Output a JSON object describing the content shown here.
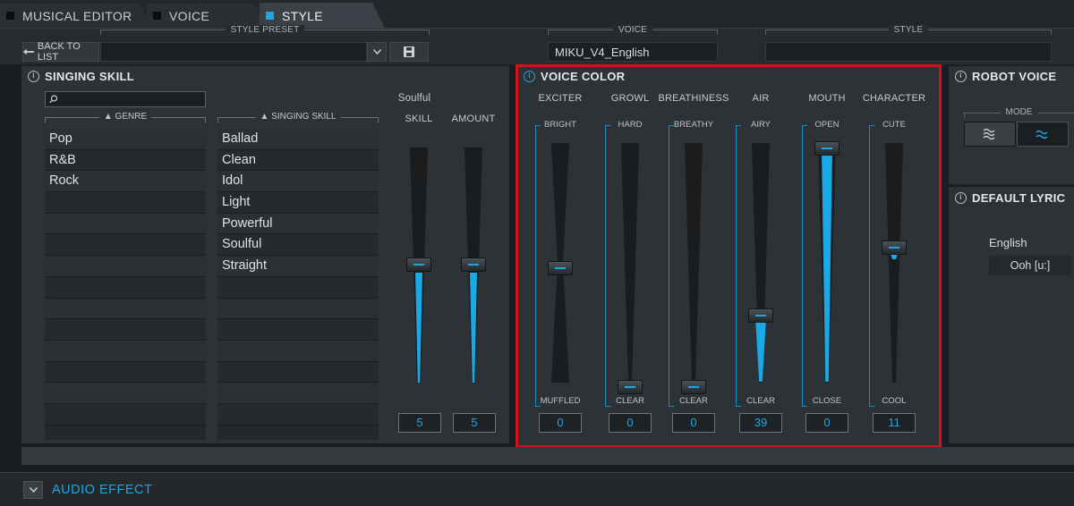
{
  "tabs": [
    {
      "label": "MUSICAL EDITOR"
    },
    {
      "label": "VOICE"
    },
    {
      "label": "STYLE"
    }
  ],
  "header": {
    "style_preset_label": "STYLE PRESET",
    "back_label": "BACK TO LIST",
    "preset_value": "",
    "voice_label": "VOICE",
    "voice_value": "MIKU_V4_English",
    "style_label": "STYLE",
    "style_value": ""
  },
  "singing_skill": {
    "title": "SINGING SKILL",
    "search_placeholder": "",
    "genre_header": "▲ GENRE",
    "skill_header": "▲ SINGING SKILL",
    "genres": [
      "Pop",
      "R&B",
      "Rock"
    ],
    "skills": [
      "Ballad",
      "Clean",
      "Idol",
      "Light",
      "Powerful",
      "Soulful",
      "Straight"
    ],
    "selected_skill": "Soulful",
    "faders": [
      {
        "name": "SKILL",
        "value": "5"
      },
      {
        "name": "AMOUNT",
        "value": "5"
      }
    ]
  },
  "voice_color": {
    "title": "VOICE COLOR",
    "faders": [
      {
        "name": "EXCITER",
        "top": "BRIGHT",
        "bottom": "MUFFLED",
        "value": "0"
      },
      {
        "name": "GROWL",
        "top": "HARD",
        "bottom": "CLEAR",
        "value": "0"
      },
      {
        "name": "BREATHINESS",
        "top": "BREATHY",
        "bottom": "CLEAR",
        "value": "0"
      },
      {
        "name": "AIR",
        "top": "AIRY",
        "bottom": "CLEAR",
        "value": "39"
      },
      {
        "name": "MOUTH",
        "top": "OPEN",
        "bottom": "CLOSE",
        "value": "0"
      },
      {
        "name": "CHARACTER",
        "top": "CUTE",
        "bottom": "COOL",
        "value": "11"
      }
    ]
  },
  "robot_voice": {
    "title": "ROBOT VOICE",
    "mode_label": "MODE",
    "modes": [
      {
        "icon": "wave-off-icon",
        "selected": false
      },
      {
        "icon": "wave-on-icon",
        "selected": true
      }
    ]
  },
  "default_lyric": {
    "title": "DEFAULT LYRIC",
    "language": "English",
    "lyric": "Ooh [u:]"
  },
  "audio_effect": {
    "title": "AUDIO EFFECT",
    "toggle_icon": "chevron-down-icon"
  },
  "colors": {
    "accent": "#1aa7e4",
    "highlight_border": "#d5101c",
    "panel_bg": "#2d3236"
  }
}
